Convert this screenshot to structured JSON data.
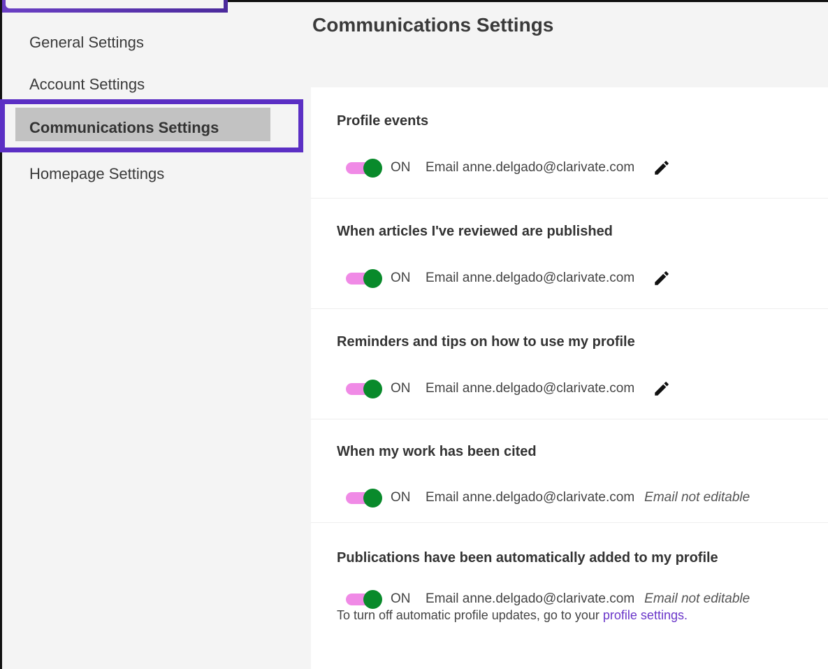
{
  "sidebar": {
    "items": [
      {
        "label": "General Settings"
      },
      {
        "label": "Account Settings"
      },
      {
        "label": "Communications Settings",
        "active": true
      },
      {
        "label": "Homepage Settings"
      }
    ]
  },
  "page": {
    "title": "Communications Settings"
  },
  "sections": [
    {
      "title": "Profile events",
      "toggle_state": "ON",
      "email": "Email anne.delgado@clarivate.com",
      "editable": true
    },
    {
      "title": "When articles I've reviewed are published",
      "toggle_state": "ON",
      "email": "Email anne.delgado@clarivate.com",
      "editable": true
    },
    {
      "title": "Reminders and tips on how to use my profile",
      "toggle_state": "ON",
      "email": "Email anne.delgado@clarivate.com",
      "editable": true
    },
    {
      "title": "When my work has been cited",
      "toggle_state": "ON",
      "email": "Email anne.delgado@clarivate.com",
      "editable": false,
      "note": "Email not editable"
    },
    {
      "title": "Publications have been automatically added to my profile",
      "toggle_state": "ON",
      "email": "Email anne.delgado@clarivate.com",
      "editable": false,
      "note": "Email not editable"
    }
  ],
  "footnote": {
    "text": "To turn off automatic profile updates, go to your ",
    "link": "profile settings."
  },
  "icons": {
    "edit": "pencil-icon",
    "toggle": "toggle-switch"
  },
  "colors": {
    "toggle_track": "#f08ae6",
    "toggle_knob": "#098a2b",
    "highlight": "#5b2fc4",
    "link": "#6a36c9"
  }
}
